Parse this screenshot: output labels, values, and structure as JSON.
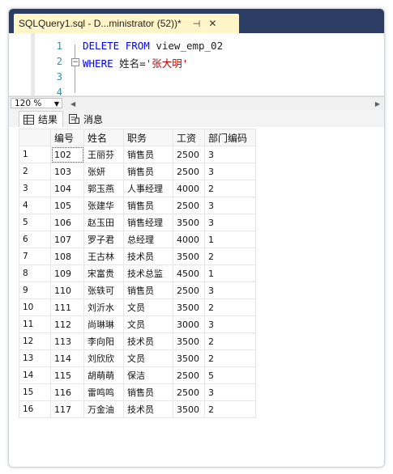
{
  "tab": {
    "title": "SQLQuery1.sql - D...ministrator (52))*",
    "pin_glyph": "⊣",
    "close_glyph": "✕"
  },
  "editor": {
    "line_numbers": [
      "1",
      "2",
      "3",
      "4"
    ],
    "line1": {
      "kw1": "DELETE",
      "kw2": "FROM",
      "ident": "view_emp_02"
    },
    "line2": {
      "kw": "WHERE",
      "ident": "姓名=",
      "str": "'张大明'"
    },
    "fold_glyph": "−"
  },
  "status": {
    "zoom": "120 %",
    "dropdown_glyph": "▼",
    "scroll_left": "◀",
    "scroll_right": "▶"
  },
  "results": {
    "tabs": [
      {
        "label": "结果",
        "icon": "grid-icon"
      },
      {
        "label": "消息",
        "icon": "message-icon"
      }
    ],
    "columns": [
      "编号",
      "姓名",
      "职务",
      "工资",
      "部门编码"
    ],
    "rows": [
      {
        "n": "1",
        "cells": [
          "102",
          "王丽芬",
          "销售员",
          "2500",
          "3"
        ]
      },
      {
        "n": "2",
        "cells": [
          "103",
          "张妍",
          "销售员",
          "2500",
          "3"
        ]
      },
      {
        "n": "3",
        "cells": [
          "104",
          "郭玉燕",
          "人事经理",
          "4000",
          "2"
        ]
      },
      {
        "n": "4",
        "cells": [
          "105",
          "张建华",
          "销售员",
          "2500",
          "3"
        ]
      },
      {
        "n": "5",
        "cells": [
          "106",
          "赵玉田",
          "销售经理",
          "3500",
          "3"
        ]
      },
      {
        "n": "6",
        "cells": [
          "107",
          "罗子君",
          "总经理",
          "4000",
          "1"
        ]
      },
      {
        "n": "7",
        "cells": [
          "108",
          "王古林",
          "技术员",
          "3500",
          "2"
        ]
      },
      {
        "n": "8",
        "cells": [
          "109",
          "宋富贵",
          "技术总监",
          "4500",
          "1"
        ]
      },
      {
        "n": "9",
        "cells": [
          "110",
          "张轶可",
          "销售员",
          "2500",
          "3"
        ]
      },
      {
        "n": "10",
        "cells": [
          "111",
          "刘沂水",
          "文员",
          "3500",
          "2"
        ]
      },
      {
        "n": "11",
        "cells": [
          "112",
          "尚琳琳",
          "文员",
          "3000",
          "3"
        ]
      },
      {
        "n": "12",
        "cells": [
          "113",
          "李向阳",
          "技术员",
          "3500",
          "2"
        ]
      },
      {
        "n": "13",
        "cells": [
          "114",
          "刘欣欣",
          "文员",
          "3500",
          "2"
        ]
      },
      {
        "n": "14",
        "cells": [
          "115",
          "胡萌萌",
          "保洁",
          "2500",
          "5"
        ]
      },
      {
        "n": "15",
        "cells": [
          "116",
          "雷鸣鸣",
          "销售员",
          "2500",
          "3"
        ]
      },
      {
        "n": "16",
        "cells": [
          "117",
          "万金油",
          "技术员",
          "3500",
          "2"
        ]
      }
    ]
  },
  "colors": {
    "tabbar": "#2b3d63",
    "active_tab": "#fff5c9",
    "keyword": "#0000ff",
    "string": "#c00000",
    "line_number": "#2b91af"
  }
}
